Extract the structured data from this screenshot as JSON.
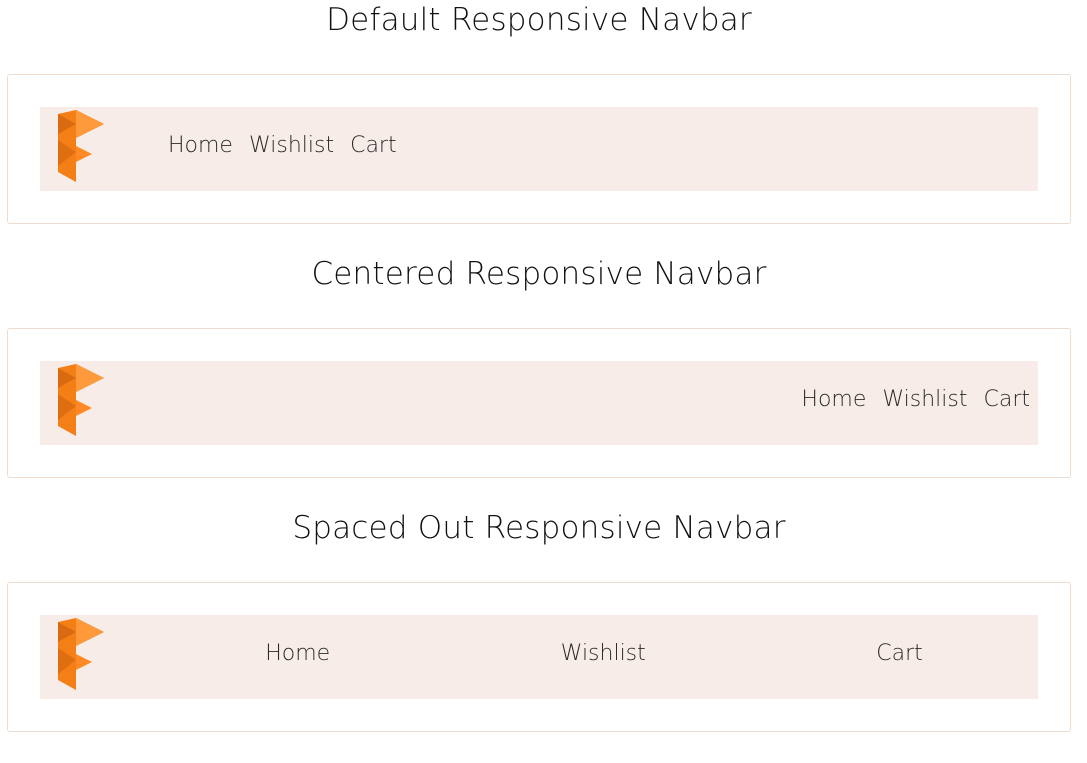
{
  "sections": [
    {
      "title": "Default Responsive Navbar",
      "links": [
        "Home",
        "Wishlist",
        "Cart"
      ]
    },
    {
      "title": "Centered Responsive Navbar",
      "links": [
        "Home",
        "Wishlist",
        "Cart"
      ]
    },
    {
      "title": "Spaced Out Responsive Navbar",
      "links": [
        "Home",
        "Wishlist",
        "Cart"
      ]
    }
  ],
  "logo": {
    "icon": "brand-logo-icon",
    "color_primary": "#f57f17",
    "color_light": "#ff9a3c",
    "color_dark": "#d96a10"
  },
  "colors": {
    "navbar_bg": "#f7ece7",
    "frame_border": "#efdccf"
  }
}
